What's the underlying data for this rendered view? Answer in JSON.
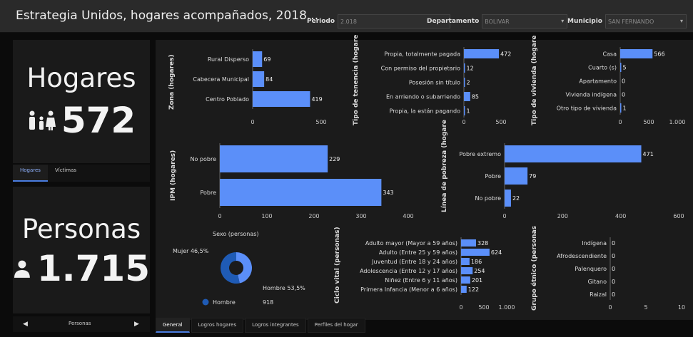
{
  "header": {
    "title": "Estrategia Unidos, hogares acompañados, 2018...",
    "filters": [
      {
        "label": "Periodo",
        "value": "2.018"
      },
      {
        "label": "Departamento",
        "value": "BOLIVAR"
      },
      {
        "label": "Municipio",
        "value": "SAN FERNANDO"
      }
    ]
  },
  "hogares_card": {
    "label": "Hogares",
    "value": "572",
    "icon": "family-icon"
  },
  "hogares_tabs": [
    "Hogares",
    "Víctimas"
  ],
  "personas_card": {
    "label": "Personas",
    "value": "1.715",
    "icon": "person-icon"
  },
  "personas_nav": {
    "label": "Personas",
    "prev": "◀",
    "next": "▶"
  },
  "bottom_tabs": [
    "General",
    "Logros hogares",
    "Logros integrantes",
    "Perfiles del hogar"
  ],
  "colors": {
    "bar": "#5b8ff9",
    "donut_dark": "#1f5bb5",
    "donut_light": "#5b8ff9"
  },
  "chart_data": [
    {
      "id": "zona",
      "type": "bar",
      "orientation": "horizontal",
      "ylabel": "Zona (hogares)",
      "categories": [
        "Rural Disperso",
        "Cabecera Municipal",
        "Centro Poblado"
      ],
      "values": [
        69,
        84,
        419
      ],
      "data_labels": [
        "69",
        "84",
        "419"
      ],
      "xlim": [
        0,
        500
      ],
      "ticks": [
        0,
        500
      ],
      "tick_labels": [
        "0",
        "500"
      ]
    },
    {
      "id": "tenencia",
      "type": "bar",
      "orientation": "horizontal",
      "ylabel": "Tipo de tenencia (hogare",
      "categories": [
        "Propia, totalmente pagada",
        "Con permiso del propietario",
        "Posesión sin título",
        "En arriendo o subarriendo",
        "Propia, la están pagando"
      ],
      "values": [
        472,
        12,
        2,
        85,
        1
      ],
      "data_labels": [
        "472",
        "12",
        "2",
        "85",
        "1"
      ],
      "xlim": [
        0,
        500
      ],
      "ticks": [
        0,
        500
      ],
      "tick_labels": [
        "0",
        "500"
      ]
    },
    {
      "id": "vivienda",
      "type": "bar",
      "orientation": "horizontal",
      "ylabel": "Tipo de vivienda (hogare",
      "categories": [
        "Casa",
        "Cuarto (s)",
        "Apartamento",
        "Vivienda indígena",
        "Otro tipo de vivienda"
      ],
      "values": [
        566,
        5,
        0,
        0,
        1
      ],
      "data_labels": [
        "566",
        "5",
        "0",
        "0",
        "1"
      ],
      "xlim": [
        0,
        1000
      ],
      "ticks": [
        0,
        500,
        1000
      ],
      "tick_labels": [
        "0",
        "500",
        "1.000"
      ]
    },
    {
      "id": "ipm",
      "type": "bar",
      "orientation": "horizontal",
      "ylabel": "IPM (hogares)",
      "categories": [
        "No pobre",
        "Pobre"
      ],
      "values": [
        229,
        343
      ],
      "data_labels": [
        "229",
        "343"
      ],
      "xlim": [
        0,
        400
      ],
      "ticks": [
        0,
        100,
        200,
        300,
        400
      ],
      "tick_labels": [
        "0",
        "100",
        "200",
        "300",
        "400"
      ]
    },
    {
      "id": "pobreza",
      "type": "bar",
      "orientation": "horizontal",
      "ylabel": "Línea de pobreza (hogare",
      "categories": [
        "Pobre extremo",
        "Pobre",
        "No pobre"
      ],
      "values": [
        471,
        79,
        22
      ],
      "data_labels": [
        "471",
        "79",
        "22"
      ],
      "xlim": [
        0,
        600
      ],
      "ticks": [
        0,
        200,
        400,
        600
      ],
      "tick_labels": [
        "0",
        "200",
        "400",
        "600"
      ]
    },
    {
      "id": "sexo",
      "type": "pie",
      "title": "Sexo (personas)",
      "categories": [
        "Mujer",
        "Hombre"
      ],
      "percent_labels": [
        "Mujer 46,5%",
        "Hombre 53,5%"
      ],
      "values": [
        797,
        918
      ],
      "legend": [
        {
          "name": "Hombre",
          "value": "918"
        }
      ]
    },
    {
      "id": "ciclo",
      "type": "bar",
      "orientation": "horizontal",
      "ylabel": "Ciclo vital (personas)",
      "categories": [
        "Adulto mayor (Mayor a 59 años)",
        "Adulto (Entre 25 y 59 años)",
        "Juventud (Entre 18 y 24 años)",
        "Adolescencia (Entre 12 y 17 años)",
        "Niñez (Entre 6 y 11 años)",
        "Primera Infancia (Menor a 6 años)"
      ],
      "values": [
        328,
        624,
        186,
        254,
        201,
        122
      ],
      "data_labels": [
        "328",
        "624",
        "186",
        "254",
        "201",
        "122"
      ],
      "xlim": [
        0,
        1000
      ],
      "ticks": [
        0,
        500,
        1000
      ],
      "tick_labels": [
        "0",
        "500",
        "1.000"
      ]
    },
    {
      "id": "etnico",
      "type": "bar",
      "orientation": "horizontal",
      "ylabel": "Grupo étnico (personas",
      "categories": [
        "Indígena",
        "Afrodescendiente",
        "Palenquero",
        "Gitano",
        "Raizal"
      ],
      "values": [
        0,
        0,
        0,
        0,
        0
      ],
      "data_labels": [
        "0",
        "0",
        "0",
        "0",
        "0"
      ],
      "xlim": [
        0,
        10
      ],
      "ticks": [
        0,
        5,
        10
      ],
      "tick_labels": [
        "0",
        "5",
        "10"
      ]
    }
  ]
}
